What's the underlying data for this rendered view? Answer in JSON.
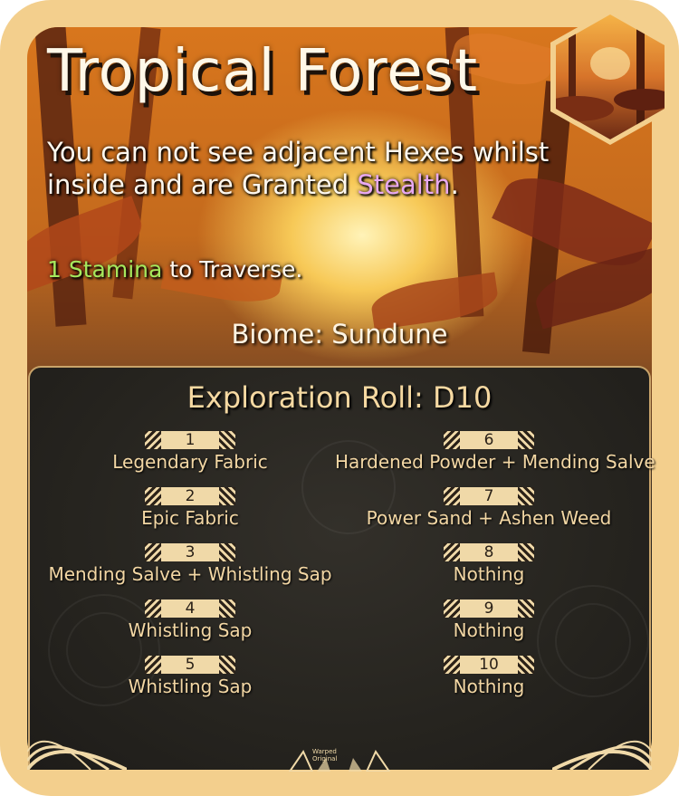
{
  "card": {
    "title": "Tropical Forest",
    "description_pre": "You can not see adjacent Hexes whilst inside and are Granted ",
    "description_keyword": "Stealth",
    "description_post": ".",
    "stamina_keyword": "1 Stamina",
    "stamina_rest": " to Traverse.",
    "biome": "Biome: Sundune",
    "roll_title": "Exploration Roll: D10",
    "logo_text_1": "Warped",
    "logo_text_2": "Original"
  },
  "rolls": [
    {
      "n": "1",
      "reward": "Legendary Fabric"
    },
    {
      "n": "2",
      "reward": "Epic Fabric"
    },
    {
      "n": "3",
      "reward": "Mending Salve + Whistling Sap"
    },
    {
      "n": "4",
      "reward": "Whistling Sap"
    },
    {
      "n": "5",
      "reward": "Whistling Sap"
    },
    {
      "n": "6",
      "reward": "Hardened Powder + Mending Salve"
    },
    {
      "n": "7",
      "reward": "Power Sand + Ashen Weed"
    },
    {
      "n": "8",
      "reward": "Nothing"
    },
    {
      "n": "9",
      "reward": "Nothing"
    },
    {
      "n": "10",
      "reward": "Nothing"
    }
  ],
  "colors": {
    "frame": "#f3cf8d",
    "stealth": "#e8a9f1",
    "stamina": "#a6e85d",
    "reward_text": "#f3d7a4",
    "badge": "#f0d9a8"
  }
}
